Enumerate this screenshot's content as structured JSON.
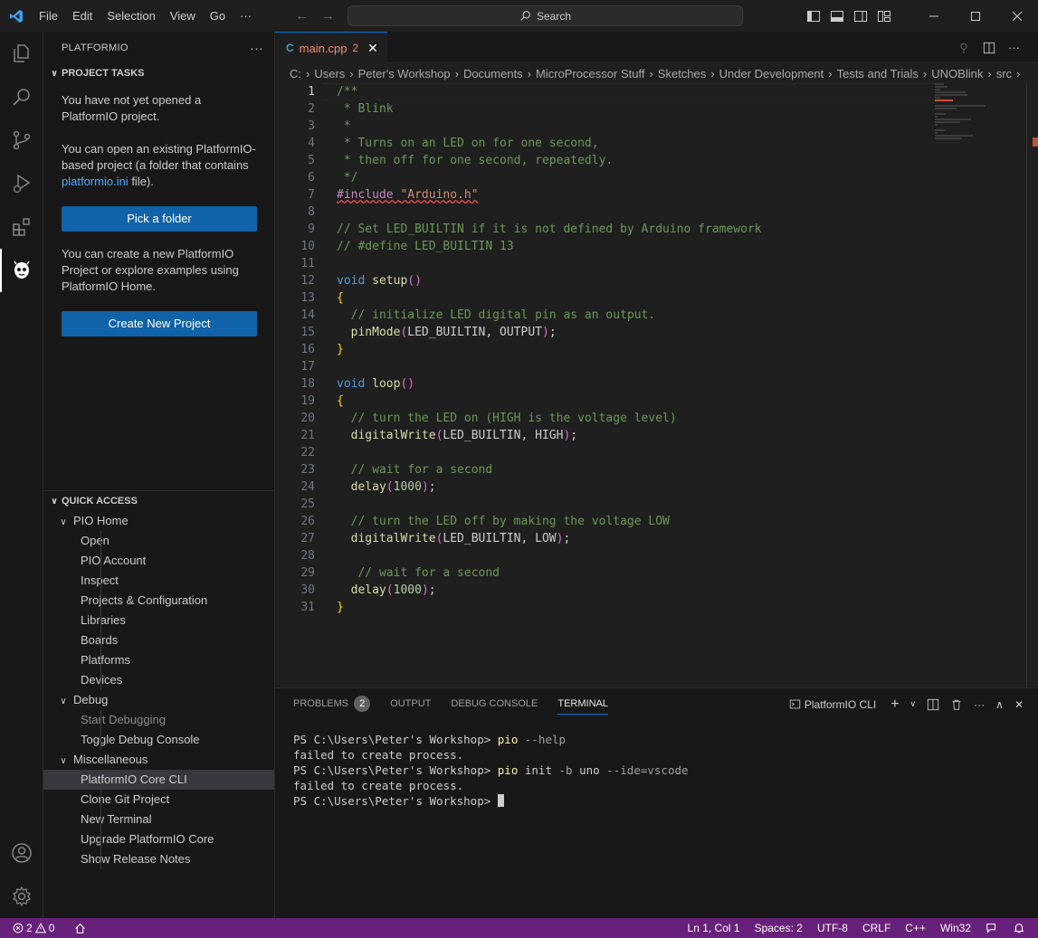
{
  "menu": [
    "File",
    "Edit",
    "Selection",
    "View",
    "Go",
    "···"
  ],
  "search": {
    "label": "Search"
  },
  "sidebar": {
    "title": "PLATFORMIO",
    "project_tasks": {
      "title": "PROJECT TASKS",
      "p1": "You have not yet opened a PlatformIO project.",
      "p2_a": "You can open an existing PlatformIO-based project (a folder that contains ",
      "p2_link": "platformio.ini",
      "p2_b": " file).",
      "pick_folder": "Pick a folder",
      "p3": "You can create a new PlatformIO Project or explore examples using PlatformIO Home.",
      "create_project": "Create New Project"
    },
    "quick_access": {
      "title": "QUICK ACCESS",
      "groups": [
        {
          "label": "PIO Home",
          "items": [
            "Open",
            "PIO Account",
            "Inspect",
            "Projects & Configuration",
            "Libraries",
            "Boards",
            "Platforms",
            "Devices"
          ]
        },
        {
          "label": "Debug",
          "items": [
            "Start Debugging",
            "Toggle Debug Console"
          ]
        },
        {
          "label": "Miscellaneous",
          "items": [
            "PlatformIO Core CLI",
            "Clone Git Project",
            "New Terminal",
            "Upgrade PlatformIO Core",
            "Show Release Notes"
          ]
        }
      ]
    }
  },
  "tab": {
    "icon": "C",
    "name": "main.cpp",
    "problems": "2"
  },
  "breadcrumb": [
    "C:",
    "Users",
    "Peter's Workshop",
    "Documents",
    "MicroProcessor Stuff",
    "Sketches",
    "Under Development",
    "Tests and Trials",
    "UNOBlink",
    "src",
    ">"
  ],
  "code": {
    "l1": "/**",
    "l2": " * Blink",
    "l3": " *",
    "l4": " * Turns on an LED on for one second,",
    "l5": " * then off for one second, repeatedly.",
    "l6": " */",
    "l7_pre": "#include ",
    "l7_str": "\"Arduino.h\"",
    "l9": "// Set LED_BUILTIN if it is not defined by Arduino framework",
    "l10": "// #define LED_BUILTIN 13",
    "void": "void",
    "setup": "setup",
    "loop": "loop",
    "l14": "  // initialize LED digital pin as an output.",
    "l15_fn": "pinMode",
    "l15_args": "LED_BUILTIN, OUTPUT",
    "l20": "  // turn the LED on (HIGH is the voltage level)",
    "dw": "digitalWrite",
    "l21_args": "LED_BUILTIN, HIGH",
    "l23": "  // wait for a second",
    "delay": "delay",
    "num": "1000",
    "l26": "  // turn the LED off by making the voltage LOW",
    "l27_args": "LED_BUILTIN, LOW",
    "l29": "   // wait for a second"
  },
  "line_numbers": [
    "1",
    "2",
    "3",
    "4",
    "5",
    "6",
    "7",
    "8",
    "9",
    "10",
    "11",
    "12",
    "13",
    "14",
    "15",
    "16",
    "17",
    "18",
    "19",
    "20",
    "21",
    "22",
    "23",
    "24",
    "25",
    "26",
    "27",
    "28",
    "29",
    "30",
    "31"
  ],
  "panel": {
    "tabs": [
      "PROBLEMS",
      "OUTPUT",
      "DEBUG CONSOLE",
      "TERMINAL"
    ],
    "problems_count": "2",
    "terminal_name": "PlatformIO CLI",
    "prompt": "PS C:\\Users\\Peter's Workshop> ",
    "cmd1": "pio",
    "cmd1_args": " --help",
    "err": "failed to create process.",
    "cmd2": "pio",
    "cmd2_args1": " init",
    "cmd2_args2": " -b",
    "cmd2_args3": " uno",
    "cmd2_args4": " --ide=vscode"
  },
  "status": {
    "errors": "2",
    "warnings": "0",
    "position": "Ln 1, Col 1",
    "spaces": "Spaces: 2",
    "encoding": "UTF-8",
    "eol": "CRLF",
    "language": "C++",
    "platform": "Win32"
  },
  "colors": {
    "status_bar": "#68217a",
    "button": "#1063a8",
    "accent": "#0078d4"
  }
}
